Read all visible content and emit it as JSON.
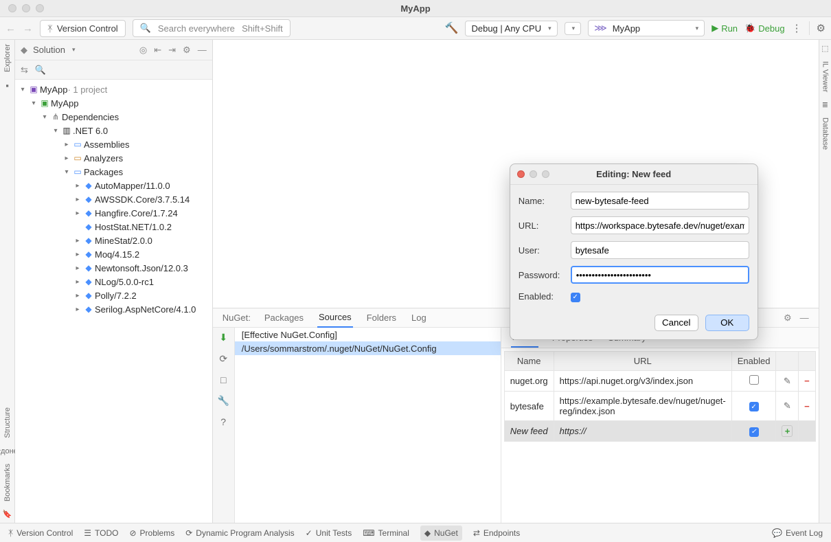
{
  "window": {
    "title": "MyApp"
  },
  "toolbar": {
    "version_control": "Version Control",
    "search_placeholder": "Search everywhere",
    "search_shortcut": "Shift+Shift",
    "run_config": "Debug | Any CPU",
    "project_selector": "MyApp",
    "run_label": "Run",
    "debug_label": "Debug"
  },
  "solution": {
    "title": "Solution",
    "root": {
      "name": "MyApp",
      "suffix": "· 1 project"
    },
    "project": "MyApp",
    "dependencies": "Dependencies",
    "net": ".NET 6.0",
    "assemblies": "Assemblies",
    "analyzers": "Analyzers",
    "packages_label": "Packages",
    "packages": [
      "AutoMapper/11.0.0",
      "AWSSDK.Core/3.7.5.14",
      "Hangfire.Core/1.7.24",
      "HostStat.NET/1.0.2",
      "MineStat/2.0.0",
      "Moq/4.15.2",
      "Newtonsoft.Json/12.0.3",
      "NLog/5.0.0-rc1",
      "Polly/7.2.2",
      "Serilog.AspNetCore/4.1.0"
    ]
  },
  "nuget": {
    "label": "NuGet:",
    "tabs": [
      "Packages",
      "Sources",
      "Folders",
      "Log"
    ],
    "active_tab": "Sources",
    "sources": {
      "rows": [
        "[Effective NuGet.Config]",
        "/Users/sommarstrom/.nuget/NuGet/NuGet.Config"
      ],
      "selected": 1
    },
    "feeds_tabs": [
      "Feeds",
      "Properties",
      "Summary"
    ],
    "feeds_active": "Feeds",
    "feeds_header": {
      "name": "Name",
      "url": "URL",
      "enabled": "Enabled"
    },
    "feeds": [
      {
        "name": "nuget.org",
        "url": "https://api.nuget.org/v3/index.json",
        "enabled": false
      },
      {
        "name": "bytesafe",
        "url": "https://example.bytesafe.dev/nuget/nuget-reg/index.json",
        "enabled": true
      },
      {
        "name": "New feed",
        "url": "https://",
        "enabled": true,
        "new": true
      }
    ]
  },
  "modal": {
    "title": "Editing: New feed",
    "labels": {
      "name": "Name:",
      "url": "URL:",
      "user": "User:",
      "password": "Password:",
      "enabled": "Enabled:"
    },
    "values": {
      "name": "new-bytesafe-feed",
      "url": "https://workspace.bytesafe.dev/nuget/exam",
      "user": "bytesafe",
      "password": "••••••••••••••••••••••••",
      "enabled": true
    },
    "buttons": {
      "cancel": "Cancel",
      "ok": "OK"
    }
  },
  "bottombar": {
    "items": [
      "Version Control",
      "TODO",
      "Problems",
      "Dynamic Program Analysis",
      "Unit Tests",
      "Terminal",
      "NuGet",
      "Endpoints"
    ],
    "active": "NuGet",
    "event_log": "Event Log"
  },
  "left_gutter": [
    "Explorer",
    "Structure",
    "Bookmarks"
  ],
  "right_gutter": [
    "IL Viewer",
    "Database"
  ]
}
